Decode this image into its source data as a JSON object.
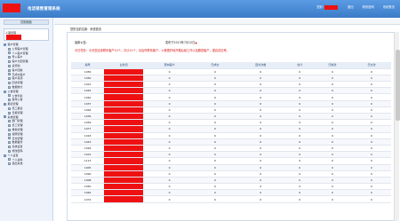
{
  "header": {
    "title": "电话销售管理系统",
    "links": [
      "您好:",
      "退出",
      "修改密码",
      "系统首页"
    ]
  },
  "sidebar": {
    "head": "控制面板",
    "user_label": "人事经理",
    "tree": [
      {
        "type": "cat",
        "label": "客户管理"
      },
      {
        "type": "child",
        "label": "公司客户管理"
      },
      {
        "type": "child",
        "label": "个人客户管理"
      },
      {
        "type": "child",
        "label": "导入客户"
      },
      {
        "type": "child",
        "label": "客户分配管理"
      },
      {
        "type": "child",
        "label": "资源池"
      },
      {
        "type": "child",
        "label": "客户回收"
      },
      {
        "type": "child",
        "label": "已成交客户"
      },
      {
        "type": "child",
        "label": "客户来源"
      },
      {
        "type": "child",
        "label": "回访管理"
      },
      {
        "type": "child",
        "label": "数据统计"
      },
      {
        "type": "cat",
        "label": "公告管理"
      },
      {
        "type": "child",
        "label": "公告列表"
      },
      {
        "type": "child",
        "label": "发布公告"
      },
      {
        "type": "cat",
        "label": "报表管理"
      },
      {
        "type": "child",
        "label": "员工报表"
      },
      {
        "type": "child",
        "label": "日报管理"
      },
      {
        "type": "cat",
        "label": "系统管理"
      },
      {
        "type": "child",
        "label": "部门管理"
      },
      {
        "type": "child",
        "label": "员工管理"
      },
      {
        "type": "child",
        "label": "角色管理"
      },
      {
        "type": "child",
        "label": "权限管理"
      },
      {
        "type": "child",
        "label": "日志管理"
      },
      {
        "type": "child",
        "label": "数据备份"
      },
      {
        "type": "child",
        "label": "系统设置"
      },
      {
        "type": "child",
        "label": "修改密码"
      },
      {
        "type": "cat",
        "label": "个人设置"
      },
      {
        "type": "child",
        "label": "个人资料"
      },
      {
        "type": "child",
        "label": "退出系统"
      }
    ]
  },
  "main": {
    "breadcrumb": "您的当前位置：系统首页",
    "latest_label": "最新公告：",
    "date_text": "发布于2013年7月12日",
    "notice_text": "今日任务：今天您应该联系客户10个，共计10个，请及时联系客户，以便更好地开展后续工作以及跟进客户，提高成交率。",
    "table": {
      "headers": [
        "编号",
        "业务员",
        "意向客户",
        "已成交",
        "回访次数",
        "合计",
        "已收款",
        "已欠款"
      ],
      "rows": [
        [
          "1056",
          "",
          "0",
          "0",
          "0",
          "0",
          "0",
          "0"
        ],
        [
          "1050",
          "",
          "0",
          "0",
          "0",
          "0",
          "0",
          "0"
        ],
        [
          "1021",
          "",
          "0",
          "0",
          "0",
          "0",
          "0",
          "0"
        ],
        [
          "1025",
          "",
          "0",
          "0",
          "0",
          "0",
          "0",
          "0"
        ],
        [
          "1040",
          "",
          "0",
          "0",
          "0",
          "0",
          "0",
          "0"
        ],
        [
          "1037",
          "",
          "0",
          "0",
          "0",
          "0",
          "0",
          "0"
        ],
        [
          "1064",
          "",
          "0",
          "0",
          "0",
          "0",
          "0",
          "0"
        ],
        [
          "1036",
          "",
          "0",
          "0",
          "0",
          "0",
          "0",
          "0"
        ],
        [
          "1059",
          "",
          "0",
          "0",
          "0",
          "0",
          "0",
          "0"
        ],
        [
          "1077",
          "",
          "0",
          "0",
          "0",
          "0",
          "0",
          "0"
        ],
        [
          "1018",
          "",
          "0",
          "0",
          "0",
          "0",
          "0",
          "0"
        ],
        [
          "1043",
          "",
          "0",
          "0",
          "0",
          "0",
          "0",
          "0"
        ],
        [
          "1026",
          "",
          "0",
          "0",
          "0",
          "0",
          "0",
          "0"
        ],
        [
          "1031",
          "",
          "0",
          "0",
          "0",
          "0",
          "0",
          "0"
        ],
        [
          "1113",
          "",
          "0",
          "0",
          "0",
          "0",
          "0",
          "0"
        ],
        [
          "1005",
          "",
          "0",
          "0",
          "0",
          "0",
          "0",
          "0"
        ],
        [
          "1090",
          "",
          "0",
          "0",
          "0",
          "0",
          "0",
          "0"
        ],
        [
          "1008",
          "",
          "0",
          "0",
          "0",
          "0",
          "0",
          "0"
        ],
        [
          "1050",
          "",
          "0",
          "0",
          "0",
          "0",
          "0",
          "0"
        ],
        [
          "1062",
          "",
          "0",
          "0",
          "0",
          "0",
          "0",
          "0"
        ],
        [
          "1074",
          "",
          "0",
          "0",
          "0",
          "0",
          "0",
          "0"
        ]
      ]
    }
  }
}
